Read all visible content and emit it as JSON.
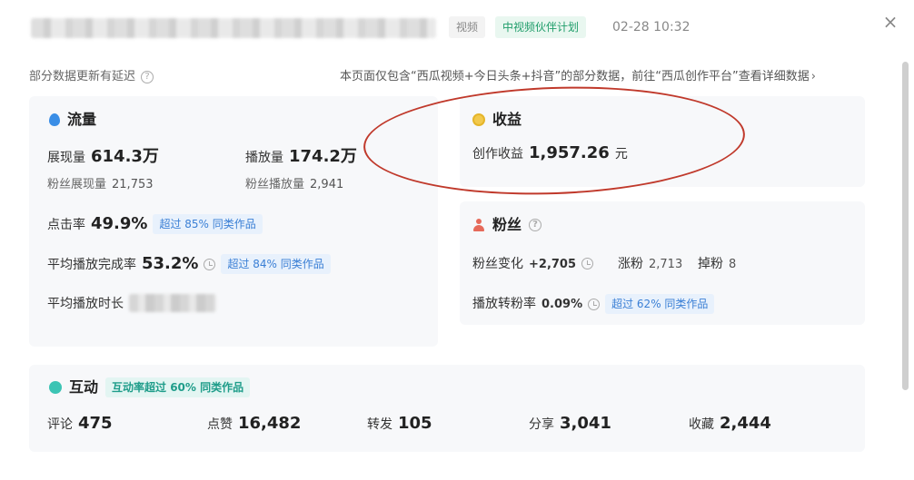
{
  "header": {
    "tag_video": "视频",
    "tag_plan": "中视频伙伴计划",
    "date": "02-28 10:32",
    "close": "×"
  },
  "notice": {
    "left": "部分数据更新有延迟",
    "right": "本页面仅包含“西瓜视频+今日头条+抖音”的部分数据，前往“西瓜创作平台”查看详细数据",
    "chevron": "›"
  },
  "traffic": {
    "title": "流量",
    "impressions_label": "展现量",
    "impressions_value": "614.3万",
    "plays_label": "播放量",
    "plays_value": "174.2万",
    "fan_impressions_label": "粉丝展现量",
    "fan_impressions_value": "21,753",
    "fan_plays_label": "粉丝播放量",
    "fan_plays_value": "2,941",
    "ctr_label": "点击率",
    "ctr_value": "49.9%",
    "ctr_badge": "超过 85% 同类作品",
    "completion_label": "平均播放完成率",
    "completion_value": "53.2%",
    "completion_badge": "超过 84% 同类作品",
    "duration_label": "平均播放时长"
  },
  "income": {
    "title": "收益",
    "creation_label": "创作收益",
    "creation_value": "1,957.26",
    "unit": "元"
  },
  "fans": {
    "title": "粉丝",
    "change_label": "粉丝变化",
    "change_value": "+2,705",
    "gain_label": "涨粉",
    "gain_value": "2,713",
    "loss_label": "掉粉",
    "loss_value": "8",
    "conv_label": "播放转粉率",
    "conv_value": "0.09%",
    "conv_badge": "超过 62% 同类作品"
  },
  "interact": {
    "title": "互动",
    "badge": "互动率超过 60% 同类作品",
    "comments_label": "评论",
    "comments_value": "475",
    "likes_label": "点赞",
    "likes_value": "16,482",
    "shares_label": "转发",
    "shares_value": "105",
    "share2_label": "分享",
    "share2_value": "3,041",
    "favs_label": "收藏",
    "favs_value": "2,444"
  },
  "colors": {
    "accent_blue": "#3a8ee6",
    "plan_green": "#1f9d6a",
    "annotation_red": "#c0392b"
  },
  "icons": {
    "traffic": "water-drop-icon",
    "income": "coin-icon",
    "fans": "person-icon",
    "interact": "chat-bubble-icon",
    "help": "question-circle-icon",
    "trend": "clock-icon"
  }
}
